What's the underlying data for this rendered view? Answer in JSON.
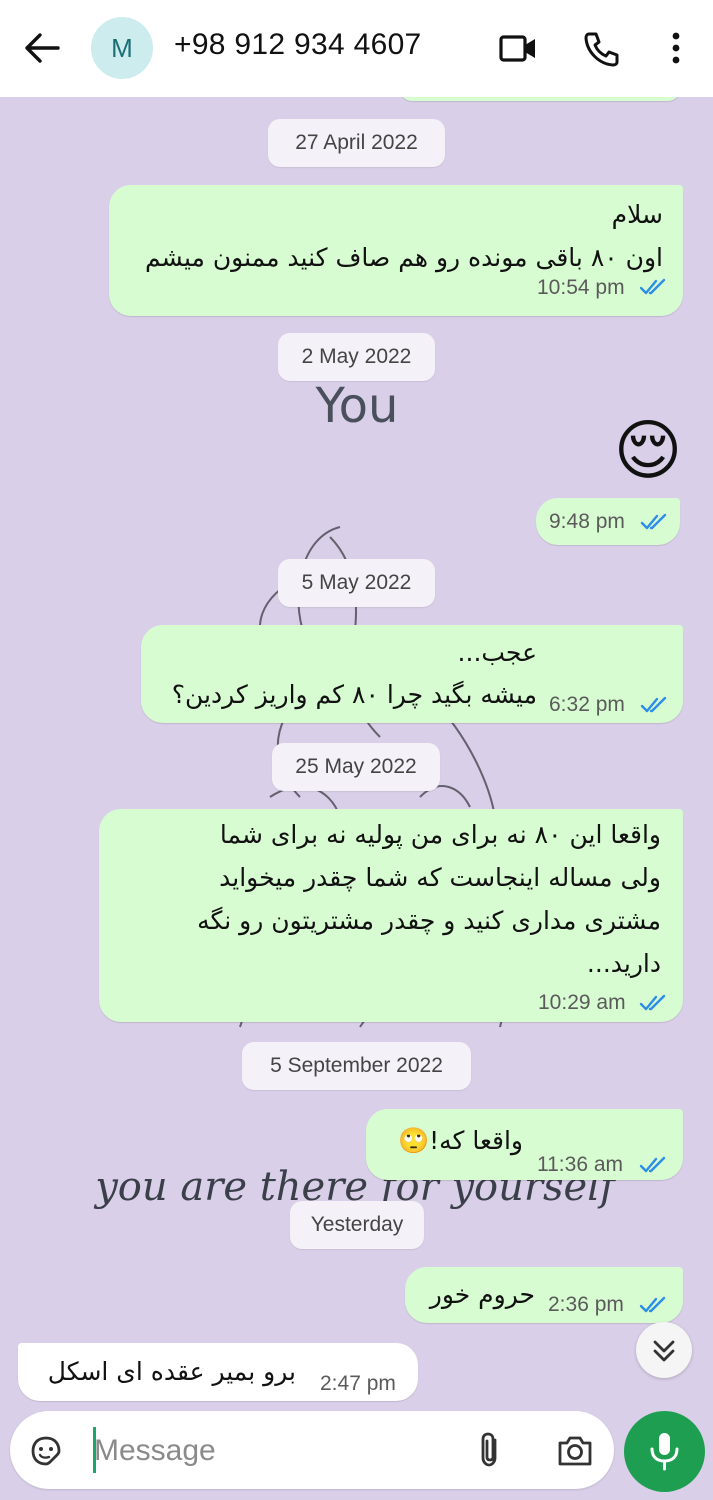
{
  "header": {
    "back_icon": "arrow-left-icon",
    "avatar_letter": "M",
    "title": "+98 912 934 4607",
    "icons": [
      "video-call-icon",
      "phone-icon",
      "more-vert-icon"
    ]
  },
  "wallpaper": {
    "word_you": "You",
    "tagline": "you are there for yourself"
  },
  "messages": [
    {
      "type": "date",
      "label": "27 April 2022"
    },
    {
      "type": "out",
      "lines": [
        "سلام",
        "اون ۸۰ باقی مونده رو هم صاف کنید ممنون میشم"
      ],
      "time": "10:54 pm",
      "status": "read"
    },
    {
      "type": "date",
      "label": "2 May 2022"
    },
    {
      "type": "out",
      "lines": [
        "😌"
      ],
      "time": "9:48 pm",
      "status": "read"
    },
    {
      "type": "date",
      "label": "5 May 2022"
    },
    {
      "type": "out",
      "lines": [
        "عجب...",
        "میشه بگید چرا ۸۰ کم واریز کردین؟"
      ],
      "time": "6:32 pm",
      "status": "read"
    },
    {
      "type": "date",
      "label": "25 May 2022"
    },
    {
      "type": "out",
      "lines": [
        "واقعا این ۸۰ نه برای من پولیه نه برای شما",
        "ولی مساله اینجاست که شما چقدر میخواید",
        "مشتری مداری کنید و چقدر مشتریتون رو نگه",
        "دارید..."
      ],
      "time": "10:29 am",
      "status": "read"
    },
    {
      "type": "date",
      "label": "5 September 2022"
    },
    {
      "type": "out",
      "lines": [
        "واقعا که!🙄"
      ],
      "time": "11:36 am",
      "status": "read"
    },
    {
      "type": "date",
      "label": "Yesterday"
    },
    {
      "type": "out",
      "lines": [
        "حروم خور"
      ],
      "time": "2:36 pm",
      "status": "read"
    },
    {
      "type": "in",
      "lines": [
        "برو بمیر عقده ای اسکل"
      ],
      "time": "2:47 pm"
    }
  ],
  "input": {
    "placeholder": "Message",
    "icons": [
      "sticker-icon",
      "attach-icon",
      "camera-icon",
      "mic-icon"
    ]
  },
  "scroll_down_icon": "double-chevron-down-icon",
  "colors": {
    "chat_background": "#d9cfe8",
    "outgoing_bubble": "#d8fcd2",
    "incoming_bubble": "#ffffff",
    "read_ticks": "#2c8ee8",
    "mic_button": "#1e9e51"
  }
}
